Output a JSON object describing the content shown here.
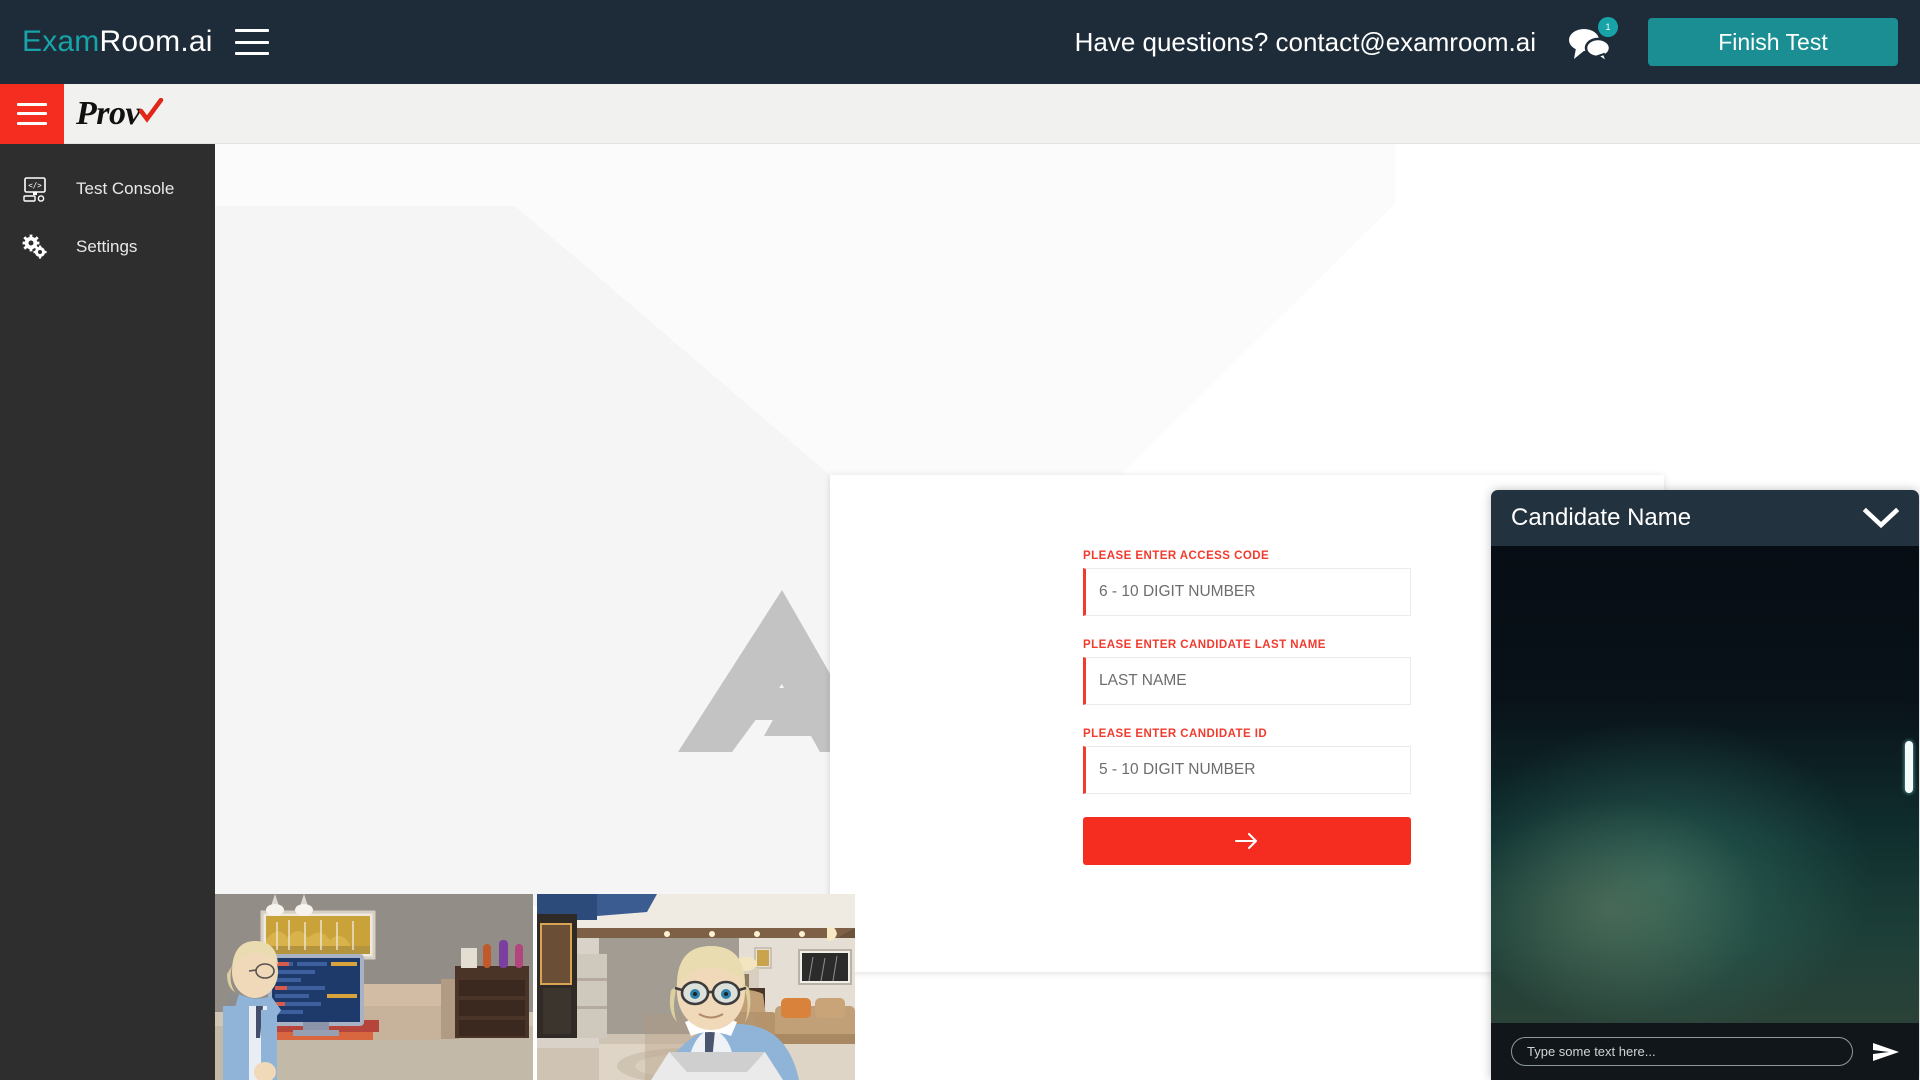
{
  "header": {
    "brand_primary": "Exam",
    "brand_secondary": "Room.ai",
    "contact_text": "Have questions? contact@examroom.ai",
    "chat_badge_count": "1",
    "finish_label": "Finish Test",
    "accent_teal": "#17a3a8",
    "button_teal": "#1a8e92",
    "bar_color": "#1e2c3a"
  },
  "subbar": {
    "partner_logo_text": "Prov",
    "accent_red": "#f42d20",
    "bg": "#f1f1f0"
  },
  "sidebar": {
    "bg": "#2e2e2e",
    "items": [
      {
        "label": "Test Console",
        "icon": "test-console-icon"
      },
      {
        "label": "Settings",
        "icon": "settings-gears-icon"
      }
    ]
  },
  "watermark": {
    "text": "EXAMROOM.AI",
    "color": "#c9c9c9"
  },
  "form": {
    "fields": [
      {
        "label": "PLEASE ENTER ACCESS CODE",
        "placeholder": "6 - 10 DIGIT NUMBER",
        "value": ""
      },
      {
        "label": "PLEASE ENTER CANDIDATE LAST NAME",
        "placeholder": "LAST NAME",
        "value": ""
      },
      {
        "label": "PLEASE ENTER CANDIDATE ID",
        "placeholder": "5 - 10 DIGIT NUMBER",
        "value": ""
      }
    ],
    "submit_icon": "arrow-right-icon",
    "label_color": "#f03b2e",
    "submit_color": "#f42d20"
  },
  "videos": [
    {
      "name": "proctor-video-tile-1"
    },
    {
      "name": "proctor-video-tile-2"
    }
  ],
  "chat": {
    "title": "Candidate Name",
    "collapse_icon": "chevron-down-icon",
    "input_placeholder": "Type some text here...",
    "input_value": "",
    "send_icon": "send-arrow-icon",
    "messages": []
  }
}
